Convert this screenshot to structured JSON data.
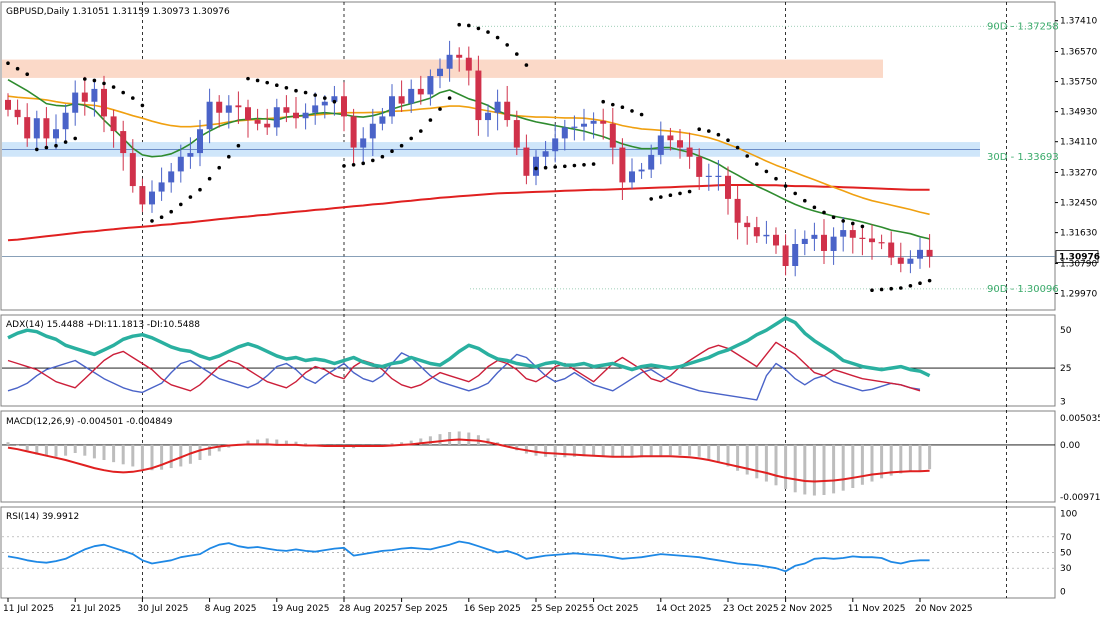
{
  "chart_data": {
    "type": "candlestick",
    "symbol_header": "GBPUSD,Daily  1.31051 1.31159 1.30973 1.30976",
    "current_price": 1.30976,
    "current_price_label": "1.30976",
    "colors": {
      "bull": "#4a63c8",
      "bear": "#d0314a",
      "ma_fast": "#2e8b2e",
      "ma_mid": "#f0a010",
      "ma_slow": "#e02020",
      "sar": "#000000",
      "adx": "#2ab0a0",
      "pdi": "#4a63c8",
      "mdi": "#cc1f3a",
      "macd_hist": "#bdbdbd",
      "macd_signal": "#e02020",
      "rsi": "#1e88e5",
      "resistance_zone": "#fbd9c8",
      "support_zone": "#cfe6fa",
      "level_label": "#3aaa6a"
    },
    "price_axis": {
      "min": 1.2952,
      "max": 1.3792,
      "ticks": [
        "1.37410",
        "1.36570",
        "1.35750",
        "1.34930",
        "1.34110",
        "1.33270",
        "1.32450",
        "1.31630",
        "1.30790",
        "1.29970"
      ]
    },
    "levels": [
      {
        "name": "90D high",
        "label": "90D - 1.37258",
        "value": 1.37258
      },
      {
        "name": "30D",
        "label": "30D - 1.33693",
        "value": 1.33693
      },
      {
        "name": "90D low",
        "label": "90D - 1.30096",
        "value": 1.30096
      }
    ],
    "zones": [
      {
        "type": "resistance",
        "from_index": 0,
        "to_index": 94,
        "low": 1.3585,
        "high": 1.3635
      },
      {
        "type": "support",
        "from_index": 0,
        "to_index": 104,
        "low": 1.337,
        "high": 1.341
      }
    ],
    "date_labels": [
      {
        "label": "11 Jul 2025",
        "index": 0
      },
      {
        "label": "21 Jul 2025",
        "index": 7
      },
      {
        "label": "30 Jul 2025",
        "index": 14
      },
      {
        "label": "8 Aug 2025",
        "index": 21
      },
      {
        "label": "19 Aug 2025",
        "index": 28
      },
      {
        "label": "28 Aug 2025",
        "index": 35
      },
      {
        "label": "7 Sep 2025",
        "index": 41
      },
      {
        "label": "16 Sep 2025",
        "index": 48
      },
      {
        "label": "25 Sep 2025",
        "index": 55
      },
      {
        "label": "5 Oct 2025",
        "index": 61
      },
      {
        "label": "14 Oct 2025",
        "index": 68
      },
      {
        "label": "23 Oct 2025",
        "index": 75
      },
      {
        "label": "2 Nov 2025",
        "index": 81
      },
      {
        "label": "11 Nov 2025",
        "index": 88
      },
      {
        "label": "20 Nov 2025",
        "index": 95
      }
    ],
    "separator_indices": [
      14,
      35,
      57,
      81,
      104
    ],
    "close": [
      1.3498,
      1.3478,
      1.342,
      1.3475,
      1.342,
      1.3445,
      1.349,
      1.3545,
      1.352,
      1.3555,
      1.348,
      1.344,
      1.338,
      1.329,
      1.324,
      1.3275,
      1.33,
      1.333,
      1.337,
      1.338,
      1.3445,
      1.352,
      1.349,
      1.351,
      1.3505,
      1.347,
      1.346,
      1.345,
      1.3505,
      1.349,
      1.3475,
      1.349,
      1.351,
      1.352,
      1.3535,
      1.348,
      1.3395,
      1.342,
      1.346,
      1.348,
      1.3535,
      1.3515,
      1.3555,
      1.354,
      1.359,
      1.361,
      1.3648,
      1.364,
      1.3605,
      1.347,
      1.349,
      1.352,
      1.347,
      1.3395,
      1.3318,
      1.337,
      1.3385,
      1.342,
      1.345,
      1.3452,
      1.346,
      1.3468,
      1.346,
      1.3395,
      1.33,
      1.333,
      1.3335,
      1.3375,
      1.3428,
      1.3415,
      1.3395,
      1.337,
      1.3315,
      1.3318,
      1.3318,
      1.3255,
      1.319,
      1.3178,
      1.3153,
      1.3157,
      1.3128,
      1.3072,
      1.3132,
      1.3146,
      1.3157,
      1.3113,
      1.3152,
      1.317,
      1.3149,
      1.3147,
      1.3137,
      1.3136,
      1.3095,
      1.3078,
      1.3092,
      1.3116,
      1.3098
    ],
    "sma20": [
      1.358,
      1.3565,
      1.355,
      1.3533,
      1.3515,
      1.351,
      1.3508,
      1.3515,
      1.351,
      1.3498,
      1.347,
      1.3445,
      1.342,
      1.3393,
      1.3375,
      1.337,
      1.3372,
      1.3378,
      1.339,
      1.3405,
      1.3425,
      1.344,
      1.3453,
      1.3462,
      1.347,
      1.3472,
      1.3474,
      1.3473,
      1.347,
      1.3478,
      1.3481,
      1.3483,
      1.3488,
      1.349,
      1.3488,
      1.3485,
      1.348,
      1.3478,
      1.3482,
      1.3489,
      1.35,
      1.3508,
      1.3515,
      1.3522,
      1.353,
      1.3545,
      1.3552,
      1.354,
      1.3528,
      1.352,
      1.351,
      1.3495,
      1.3485,
      1.348,
      1.3472,
      1.3465,
      1.346,
      1.3455,
      1.345,
      1.3445,
      1.344,
      1.3432,
      1.3425,
      1.3415,
      1.3405,
      1.3398,
      1.3392,
      1.3392,
      1.3395,
      1.3395,
      1.3388,
      1.3382,
      1.3372,
      1.3362,
      1.335,
      1.3334,
      1.332,
      1.3305,
      1.329,
      1.3278,
      1.3265,
      1.3252,
      1.324,
      1.323,
      1.3222,
      1.3215,
      1.3208,
      1.3203,
      1.3198,
      1.3192,
      1.3185,
      1.3178,
      1.317,
      1.3165,
      1.316,
      1.3152,
      1.3146
    ],
    "sma50": [
      1.3535,
      1.3532,
      1.353,
      1.3528,
      1.3525,
      1.352,
      1.3516,
      1.3514,
      1.3512,
      1.351,
      1.3505,
      1.3498,
      1.349,
      1.3482,
      1.3475,
      1.3467,
      1.346,
      1.3455,
      1.3452,
      1.3452,
      1.3454,
      1.3457,
      1.346,
      1.3465,
      1.3468,
      1.347,
      1.3472,
      1.3474,
      1.3476,
      1.3478,
      1.348,
      1.3482,
      1.3484,
      1.3486,
      1.3488,
      1.349,
      1.349,
      1.349,
      1.3491,
      1.3492,
      1.3494,
      1.3495,
      1.3497,
      1.35,
      1.3502,
      1.3505,
      1.3508,
      1.3508,
      1.3505,
      1.35,
      1.3495,
      1.349,
      1.3485,
      1.3482,
      1.348,
      1.3478,
      1.3478,
      1.3477,
      1.3476,
      1.3476,
      1.3475,
      1.3472,
      1.3468,
      1.3462,
      1.3455,
      1.345,
      1.3446,
      1.3444,
      1.3442,
      1.344,
      1.3437,
      1.3433,
      1.3428,
      1.3422,
      1.3414,
      1.3404,
      1.3394,
      1.3382,
      1.337,
      1.3358,
      1.3347,
      1.3337,
      1.3327,
      1.3317,
      1.3307,
      1.3297,
      1.3287,
      1.3277,
      1.3267,
      1.3258,
      1.325,
      1.3244,
      1.3238,
      1.3232,
      1.3226,
      1.3219,
      1.3213
    ],
    "sma200": [
      1.3142,
      1.3144,
      1.3147,
      1.315,
      1.3153,
      1.3156,
      1.3159,
      1.3162,
      1.3165,
      1.3167,
      1.317,
      1.3172,
      1.3175,
      1.3177,
      1.3179,
      1.3181,
      1.3184,
      1.3186,
      1.3189,
      1.3191,
      1.3194,
      1.3197,
      1.32,
      1.3202,
      1.3205,
      1.3207,
      1.321,
      1.3212,
      1.3215,
      1.3217,
      1.322,
      1.3222,
      1.3225,
      1.3227,
      1.323,
      1.3232,
      1.3235,
      1.3237,
      1.324,
      1.3242,
      1.3245,
      1.3248,
      1.325,
      1.3253,
      1.3255,
      1.3258,
      1.326,
      1.3262,
      1.3264,
      1.3266,
      1.3268,
      1.327,
      1.3271,
      1.3272,
      1.3273,
      1.3274,
      1.3275,
      1.3276,
      1.3277,
      1.3278,
      1.3279,
      1.328,
      1.328,
      1.3281,
      1.3282,
      1.3283,
      1.3284,
      1.3285,
      1.3286,
      1.3287,
      1.3288,
      1.3289,
      1.329,
      1.3291,
      1.3292,
      1.3293,
      1.3293,
      1.3293,
      1.3293,
      1.3292,
      1.3292,
      1.3291,
      1.329,
      1.329,
      1.3289,
      1.3288,
      1.3288,
      1.3287,
      1.3286,
      1.3285,
      1.3284,
      1.3283,
      1.3282,
      1.3281,
      1.328,
      1.328,
      1.328
    ],
    "sar": [
      1.3625,
      1.361,
      1.3595,
      1.339,
      1.3395,
      1.34,
      1.341,
      1.342,
      1.3582,
      1.3578,
      1.357,
      1.356,
      1.3545,
      1.353,
      1.351,
      1.3195,
      1.3205,
      1.322,
      1.324,
      1.326,
      1.328,
      1.331,
      1.334,
      1.337,
      1.34,
      1.3583,
      1.3578,
      1.3572,
      1.3565,
      1.3558,
      1.355,
      1.3545,
      1.3538,
      1.353,
      1.352,
      1.3345,
      1.3348,
      1.3352,
      1.336,
      1.337,
      1.3385,
      1.34,
      1.342,
      1.344,
      1.347,
      1.35,
      1.353,
      1.373,
      1.3728,
      1.372,
      1.371,
      1.3695,
      1.3675,
      1.365,
      1.362,
      1.3338,
      1.334,
      1.3342,
      1.3344,
      1.3346,
      1.3348,
      1.335,
      1.352,
      1.3512,
      1.3505,
      1.3495,
      1.3485,
      1.3255,
      1.326,
      1.3265,
      1.327,
      1.3275,
      1.3445,
      1.344,
      1.343,
      1.3415,
      1.3395,
      1.3372,
      1.335,
      1.333,
      1.331,
      1.329,
      1.327,
      1.325,
      1.3232,
      1.3218,
      1.3205,
      1.3195,
      1.3188,
      1.318,
      1.3006,
      1.3008,
      1.301,
      1.3012,
      1.3018,
      1.3025,
      1.3032
    ],
    "adx": {
      "label": "ADX(14) 15.4488 +DI:11.1813 -DI:10.5488",
      "axis_ticks": [
        "50",
        "25",
        "3"
      ],
      "reference_level": 25,
      "adx": [
        45,
        48,
        50,
        49,
        46,
        44,
        40,
        38,
        36,
        34,
        37,
        40,
        44,
        46,
        47,
        45,
        42,
        39,
        37,
        36,
        33,
        31,
        33,
        36,
        39,
        41,
        39,
        36,
        33,
        31,
        32,
        30,
        31,
        30,
        28,
        30,
        32,
        29,
        27,
        26,
        28,
        29,
        32,
        30,
        28,
        27,
        31,
        36,
        40,
        38,
        34,
        31,
        30,
        28,
        27,
        26,
        28,
        29,
        27,
        27,
        28,
        26,
        27,
        28,
        26,
        24,
        26,
        27,
        26,
        25,
        26,
        28,
        30,
        32,
        35,
        37,
        40,
        43,
        47,
        50,
        54,
        58,
        55,
        48,
        43,
        39,
        35,
        30,
        28,
        26,
        25,
        24,
        25,
        26,
        24,
        23,
        20
      ],
      "pdi": [
        10,
        12,
        15,
        20,
        24,
        26,
        28,
        30,
        26,
        22,
        18,
        15,
        12,
        10,
        9,
        12,
        15,
        22,
        28,
        30,
        26,
        22,
        18,
        16,
        14,
        12,
        15,
        20,
        26,
        28,
        24,
        18,
        15,
        20,
        24,
        28,
        22,
        18,
        16,
        20,
        28,
        35,
        32,
        26,
        20,
        16,
        14,
        12,
        10,
        12,
        15,
        22,
        28,
        34,
        32,
        26,
        20,
        16,
        18,
        22,
        18,
        14,
        12,
        10,
        14,
        18,
        22,
        24,
        20,
        16,
        14,
        12,
        10,
        9,
        8,
        7,
        6,
        5,
        4,
        20,
        28,
        24,
        18,
        14,
        18,
        20,
        16,
        14,
        12,
        10,
        11,
        13,
        15,
        14,
        12,
        11
      ],
      "mdi": [
        30,
        28,
        26,
        24,
        20,
        16,
        14,
        12,
        18,
        24,
        30,
        34,
        36,
        32,
        28,
        24,
        18,
        14,
        12,
        10,
        14,
        20,
        26,
        30,
        28,
        24,
        20,
        16,
        14,
        12,
        16,
        22,
        26,
        24,
        20,
        18,
        26,
        30,
        28,
        24,
        18,
        14,
        12,
        14,
        18,
        22,
        20,
        18,
        16,
        20,
        26,
        30,
        28,
        24,
        18,
        16,
        20,
        26,
        28,
        24,
        20,
        16,
        22,
        28,
        32,
        28,
        24,
        18,
        16,
        20,
        26,
        30,
        34,
        38,
        40,
        38,
        34,
        30,
        26,
        34,
        42,
        38,
        34,
        28,
        22,
        20,
        24,
        22,
        20,
        18,
        17,
        16,
        15,
        14,
        12,
        10
      ]
    },
    "macd": {
      "label": "MACD(12,26,9) -0.004501 -0.004849",
      "axis_ticks": [
        "0.005035",
        "0.00",
        "-0.009713"
      ],
      "histogram": [
        0.0005,
        0.0,
        -0.001,
        -0.0018,
        -0.002,
        -0.0022,
        -0.002,
        -0.0015,
        -0.002,
        -0.0025,
        -0.0028,
        -0.0032,
        -0.0036,
        -0.004,
        -0.0045,
        -0.0047,
        -0.0046,
        -0.0043,
        -0.004,
        -0.0035,
        -0.0028,
        -0.002,
        -0.0012,
        -0.0005,
        0.0002,
        0.0008,
        0.001,
        0.0012,
        0.001,
        0.0008,
        0.0006,
        0.0003,
        0.0001,
        -0.0002,
        -0.0003,
        -0.0004,
        -0.0006,
        -0.0004,
        -0.0002,
        0.0,
        0.0003,
        0.0005,
        0.0008,
        0.0012,
        0.0016,
        0.002,
        0.0024,
        0.0025,
        0.0023,
        0.0018,
        0.0012,
        0.0005,
        -0.0003,
        -0.001,
        -0.0016,
        -0.002,
        -0.0022,
        -0.0023,
        -0.0023,
        -0.0022,
        -0.0021,
        -0.002,
        -0.002,
        -0.0021,
        -0.0022,
        -0.0022,
        -0.0023,
        -0.0022,
        -0.002,
        -0.0019,
        -0.0019,
        -0.002,
        -0.0022,
        -0.0026,
        -0.0032,
        -0.004,
        -0.0048,
        -0.0055,
        -0.0062,
        -0.0068,
        -0.0075,
        -0.0082,
        -0.0088,
        -0.0092,
        -0.0094,
        -0.0093,
        -0.009,
        -0.0085,
        -0.008,
        -0.0074,
        -0.0068,
        -0.0062,
        -0.0057,
        -0.0053,
        -0.005,
        -0.0048,
        -0.0045
      ],
      "signal": [
        -0.0005,
        -0.0008,
        -0.0012,
        -0.0016,
        -0.002,
        -0.0024,
        -0.0028,
        -0.0033,
        -0.0038,
        -0.0043,
        -0.0047,
        -0.005,
        -0.0051,
        -0.005,
        -0.0047,
        -0.0043,
        -0.0037,
        -0.003,
        -0.0023,
        -0.0016,
        -0.001,
        -0.0006,
        -0.0003,
        -0.0001,
        0.0,
        0.0001,
        0.0001,
        0.0001,
        0.0,
        0.0,
        0.0,
        -0.0001,
        -0.0001,
        -0.0002,
        -0.0002,
        -0.0002,
        -0.0002,
        -0.0002,
        -0.0002,
        -0.0002,
        -0.0001,
        0.0,
        0.0001,
        0.0003,
        0.0005,
        0.0007,
        0.0009,
        0.001,
        0.0009,
        0.0008,
        0.0005,
        0.0001,
        -0.0003,
        -0.0007,
        -0.001,
        -0.0013,
        -0.0015,
        -0.0016,
        -0.0017,
        -0.0018,
        -0.0019,
        -0.002,
        -0.0021,
        -0.0022,
        -0.0022,
        -0.0022,
        -0.0021,
        -0.0021,
        -0.0021,
        -0.0021,
        -0.0022,
        -0.0023,
        -0.0025,
        -0.0028,
        -0.0032,
        -0.0036,
        -0.004,
        -0.0044,
        -0.0048,
        -0.0052,
        -0.0057,
        -0.0061,
        -0.0064,
        -0.0067,
        -0.0068,
        -0.0067,
        -0.0066,
        -0.0064,
        -0.0061,
        -0.0058,
        -0.0055,
        -0.0053,
        -0.0051,
        -0.005,
        -0.0049,
        -0.0049,
        -0.0048
      ]
    },
    "rsi": {
      "label": "RSI(14) 39.9912",
      "axis_ticks": [
        "100",
        "70",
        "50",
        "30",
        "0"
      ],
      "levels": [
        70,
        50,
        30
      ],
      "values": [
        45,
        43,
        40,
        38,
        37,
        39,
        42,
        48,
        54,
        58,
        60,
        56,
        52,
        48,
        40,
        36,
        38,
        40,
        44,
        46,
        48,
        55,
        60,
        62,
        58,
        56,
        57,
        55,
        53,
        52,
        54,
        52,
        51,
        53,
        55,
        56,
        46,
        48,
        50,
        52,
        53,
        55,
        56,
        55,
        54,
        57,
        60,
        64,
        62,
        58,
        54,
        50,
        52,
        48,
        42,
        44,
        46,
        47,
        48,
        49,
        48,
        47,
        46,
        44,
        42,
        43,
        44,
        46,
        48,
        47,
        46,
        45,
        44,
        42,
        40,
        38,
        36,
        35,
        34,
        32,
        30,
        26,
        33,
        36,
        42,
        43,
        42,
        43,
        45,
        44,
        44,
        43,
        38,
        36,
        39,
        40,
        40
      ]
    }
  }
}
